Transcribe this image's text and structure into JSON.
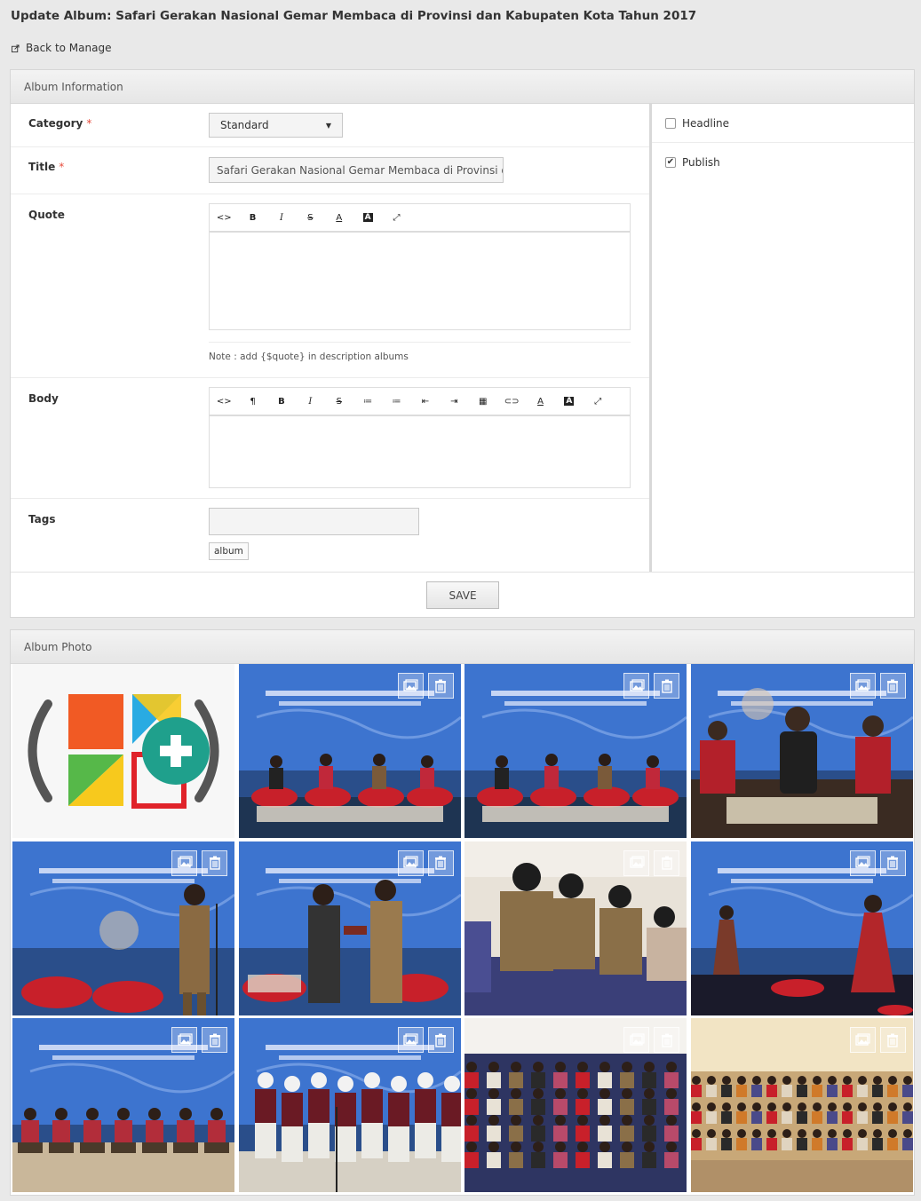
{
  "page": {
    "title": "Update Album: Safari Gerakan Nasional Gemar Membaca di Provinsi dan Kabupaten Kota Tahun 2017",
    "back_label": "Back to Manage"
  },
  "album_info": {
    "panel_title": "Album Information",
    "category": {
      "label": "Category",
      "required_mark": "*",
      "value": "Standard"
    },
    "title": {
      "label": "Title",
      "required_mark": "*",
      "value": "Safari Gerakan Nasional Gemar Membaca di Provinsi dan K"
    },
    "quote": {
      "label": "Quote",
      "toolbar": [
        "<>",
        "B",
        "I",
        "S",
        "A",
        "A",
        "⤢"
      ],
      "note": "Note : add {$quote} in description albums"
    },
    "body": {
      "label": "Body",
      "toolbar": [
        "<>",
        "¶",
        "B",
        "I",
        "S",
        "≔",
        "≔",
        "⇤",
        "⇥",
        "▦",
        "⊂⊃",
        "A",
        "A",
        "⤢"
      ]
    },
    "tags": {
      "label": "Tags",
      "value": "",
      "chips": [
        "album"
      ]
    },
    "options": {
      "headline": {
        "label": "Headline",
        "checked": false
      },
      "publish": {
        "label": "Publish",
        "checked": true
      }
    },
    "save_label": "SAVE"
  },
  "album_photo": {
    "panel_title": "Album Photo",
    "photos": [
      {
        "scene": "add-photo"
      },
      {
        "scene": "panel-discussion"
      },
      {
        "scene": "panel-discussion"
      },
      {
        "scene": "speaker-closeup"
      },
      {
        "scene": "speaker-standing"
      },
      {
        "scene": "handshake"
      },
      {
        "scene": "audience-officials"
      },
      {
        "scene": "dancer"
      },
      {
        "scene": "dance-group"
      },
      {
        "scene": "choir"
      },
      {
        "scene": "audience-hall"
      },
      {
        "scene": "audience-hall-wide"
      }
    ]
  }
}
